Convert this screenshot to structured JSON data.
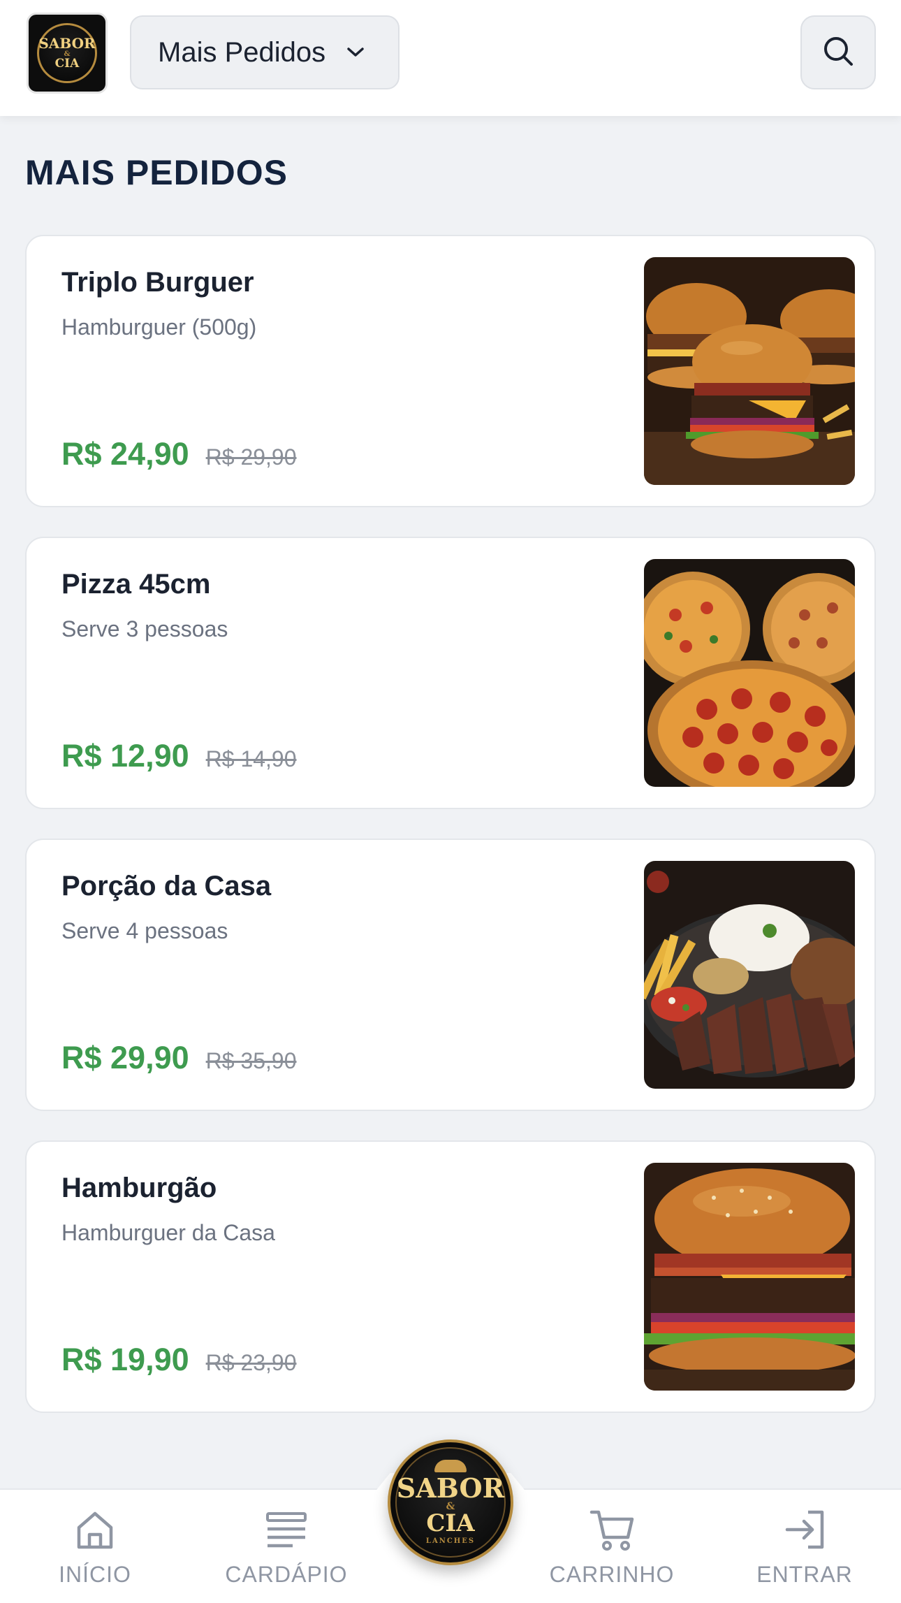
{
  "header": {
    "logo": {
      "line1": "SABOR",
      "line2": "&",
      "line3": "CIA"
    },
    "category_label": "Mais Pedidos",
    "chevron_icon": "chevron-down-icon",
    "search_icon": "search-icon"
  },
  "section": {
    "title": "MAIS PEDIDOS"
  },
  "products": [
    {
      "name": "Triplo Burguer",
      "description": "Hamburguer (500g)",
      "price": "R$ 24,90",
      "old_price": "R$ 29,90",
      "image": "triple-burger-image"
    },
    {
      "name": "Pizza 45cm",
      "description": "Serve 3 pessoas",
      "price": "R$ 12,90",
      "old_price": "R$ 14,90",
      "image": "pizza-image"
    },
    {
      "name": "Porção da Casa",
      "description": "Serve 4 pessoas",
      "price": "R$ 29,90",
      "old_price": "R$ 35,90",
      "image": "house-platter-image"
    },
    {
      "name": "Hamburgão",
      "description": "Hamburguer da Casa",
      "price": "R$ 19,90",
      "old_price": "R$ 23,90",
      "image": "big-burger-image"
    }
  ],
  "bottom_nav": {
    "items": [
      {
        "label": "INÍCIO",
        "icon": "home-icon"
      },
      {
        "label": "CARDÁPIO",
        "icon": "menu-icon"
      },
      {
        "label": "CARRINHO",
        "icon": "cart-icon"
      },
      {
        "label": "ENTRAR",
        "icon": "login-icon"
      }
    ],
    "center_logo": {
      "line1": "SABOR",
      "line2": "&",
      "line3": "CIA",
      "line4": "LANCHES"
    }
  },
  "colors": {
    "price": "#3e9b4f",
    "title": "#14233d",
    "background": "#f0f2f5"
  }
}
